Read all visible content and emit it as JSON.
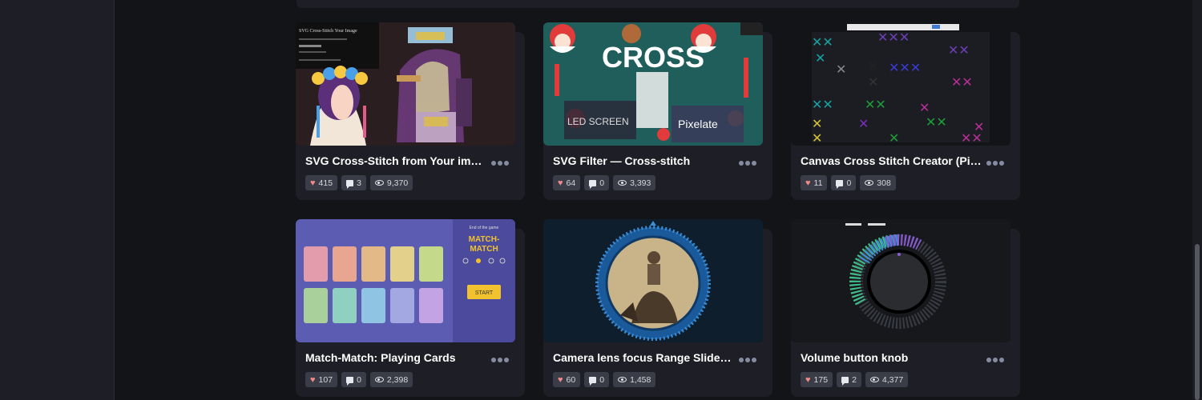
{
  "cards": [
    {
      "title": "SVG Cross-Stitch from Your image",
      "likes": "415",
      "comments": "3",
      "views": "9,370",
      "preview_text": [
        "SVG Cross-Stitch Your Image"
      ]
    },
    {
      "title": "SVG Filter — Cross-stitch",
      "likes": "64",
      "comments": "0",
      "views": "3,393",
      "preview_text": [
        "CROSS",
        "LED SCREEN",
        "Pixelate"
      ]
    },
    {
      "title": "Canvas Cross Stitch Creator (Pix…",
      "likes": "11",
      "comments": "0",
      "views": "308",
      "preview_text": []
    },
    {
      "title": "Match-Match: Playing Cards",
      "likes": "107",
      "comments": "0",
      "views": "2,398",
      "preview_text": [
        "End of the game",
        "MATCH-",
        "MATCH",
        "START"
      ]
    },
    {
      "title": "Camera lens focus Range Sliders …",
      "likes": "60",
      "comments": "0",
      "views": "1,458",
      "preview_text": []
    },
    {
      "title": "Volume button knob",
      "likes": "175",
      "comments": "2",
      "views": "4,377",
      "preview_text": []
    }
  ],
  "icons": {
    "likes": "heart-icon",
    "comments": "comment-icon",
    "views": "eye-icon",
    "more": "more-options-icon"
  }
}
